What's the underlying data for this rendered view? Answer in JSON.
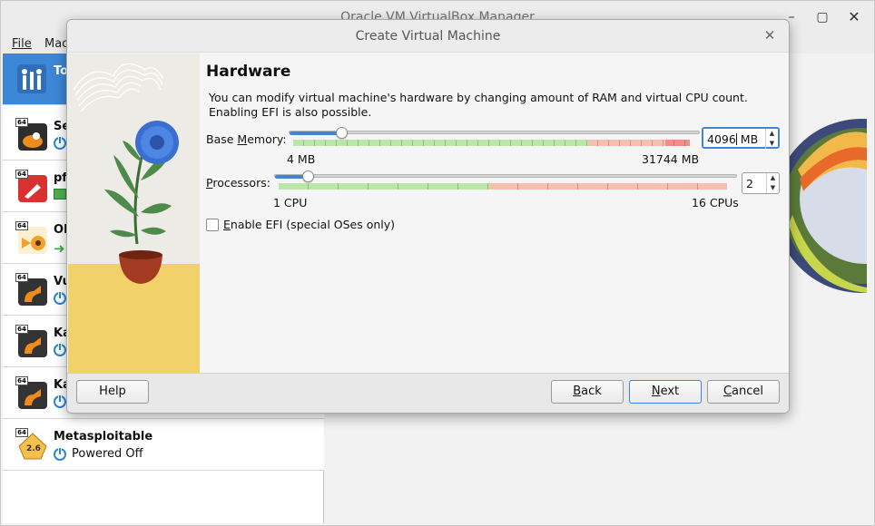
{
  "manager": {
    "title": "Oracle VM VirtualBox Manager",
    "menu": {
      "file": "File",
      "machine": "Mac"
    },
    "window_controls": {
      "minimize": "–",
      "maximize": "▢",
      "close": "✕"
    },
    "vms": [
      {
        "name": "To",
        "state": "",
        "os_color": "#2e6db5",
        "selected": true
      },
      {
        "name": "Se",
        "state": "",
        "os_color": "#e47a20"
      },
      {
        "name": "pf",
        "state": "",
        "os_color": "#d8312f"
      },
      {
        "name": "OP",
        "state": "",
        "os_color": "#f0a12b"
      },
      {
        "name": "Vu",
        "state": "",
        "os_color": "#f08c1d"
      },
      {
        "name": "Ka",
        "state": "",
        "os_color": "#f08c1d"
      },
      {
        "name": "Ka",
        "state": "",
        "os_color": "#f08c1d"
      },
      {
        "name": "Metasploitable",
        "state": "Powered Off",
        "badge": "2.6",
        "os_color": "#f5c04b"
      }
    ]
  },
  "dialog": {
    "title": "Create Virtual Machine",
    "close": "✕",
    "heading": "Hardware",
    "description_1": "You can modify virtual machine's hardware by changing amount of RAM and virtual CPU count.",
    "description_2": "Enabling EFI is also possible.",
    "memory": {
      "label_pre": "Base ",
      "label_ul": "M",
      "label_post": "emory:",
      "value": "4096",
      "unit": "MB",
      "min_label": "4 MB",
      "max_label": "31744 MB",
      "min": 4,
      "max": 31744,
      "current": 4096
    },
    "processors": {
      "label_ul": "P",
      "label_post": "rocessors:",
      "value": "2",
      "min_label": "1 CPU",
      "max_label": "16 CPUs",
      "min": 1,
      "max": 16,
      "current": 2
    },
    "efi": {
      "label_ul": "E",
      "label_post": "nable EFI (special OSes only)",
      "checked": false
    },
    "buttons": {
      "help": "Help",
      "back_ul": "B",
      "back_post": "ack",
      "next_ul": "N",
      "next_post": "ext",
      "cancel_ul": "C",
      "cancel_post": "ancel"
    }
  },
  "colors": {
    "accent": "#3d87d6",
    "safe_zone": "#b7e8a8",
    "warn_zone": "#f6c0ac",
    "danger_zone": "#f08f88"
  }
}
